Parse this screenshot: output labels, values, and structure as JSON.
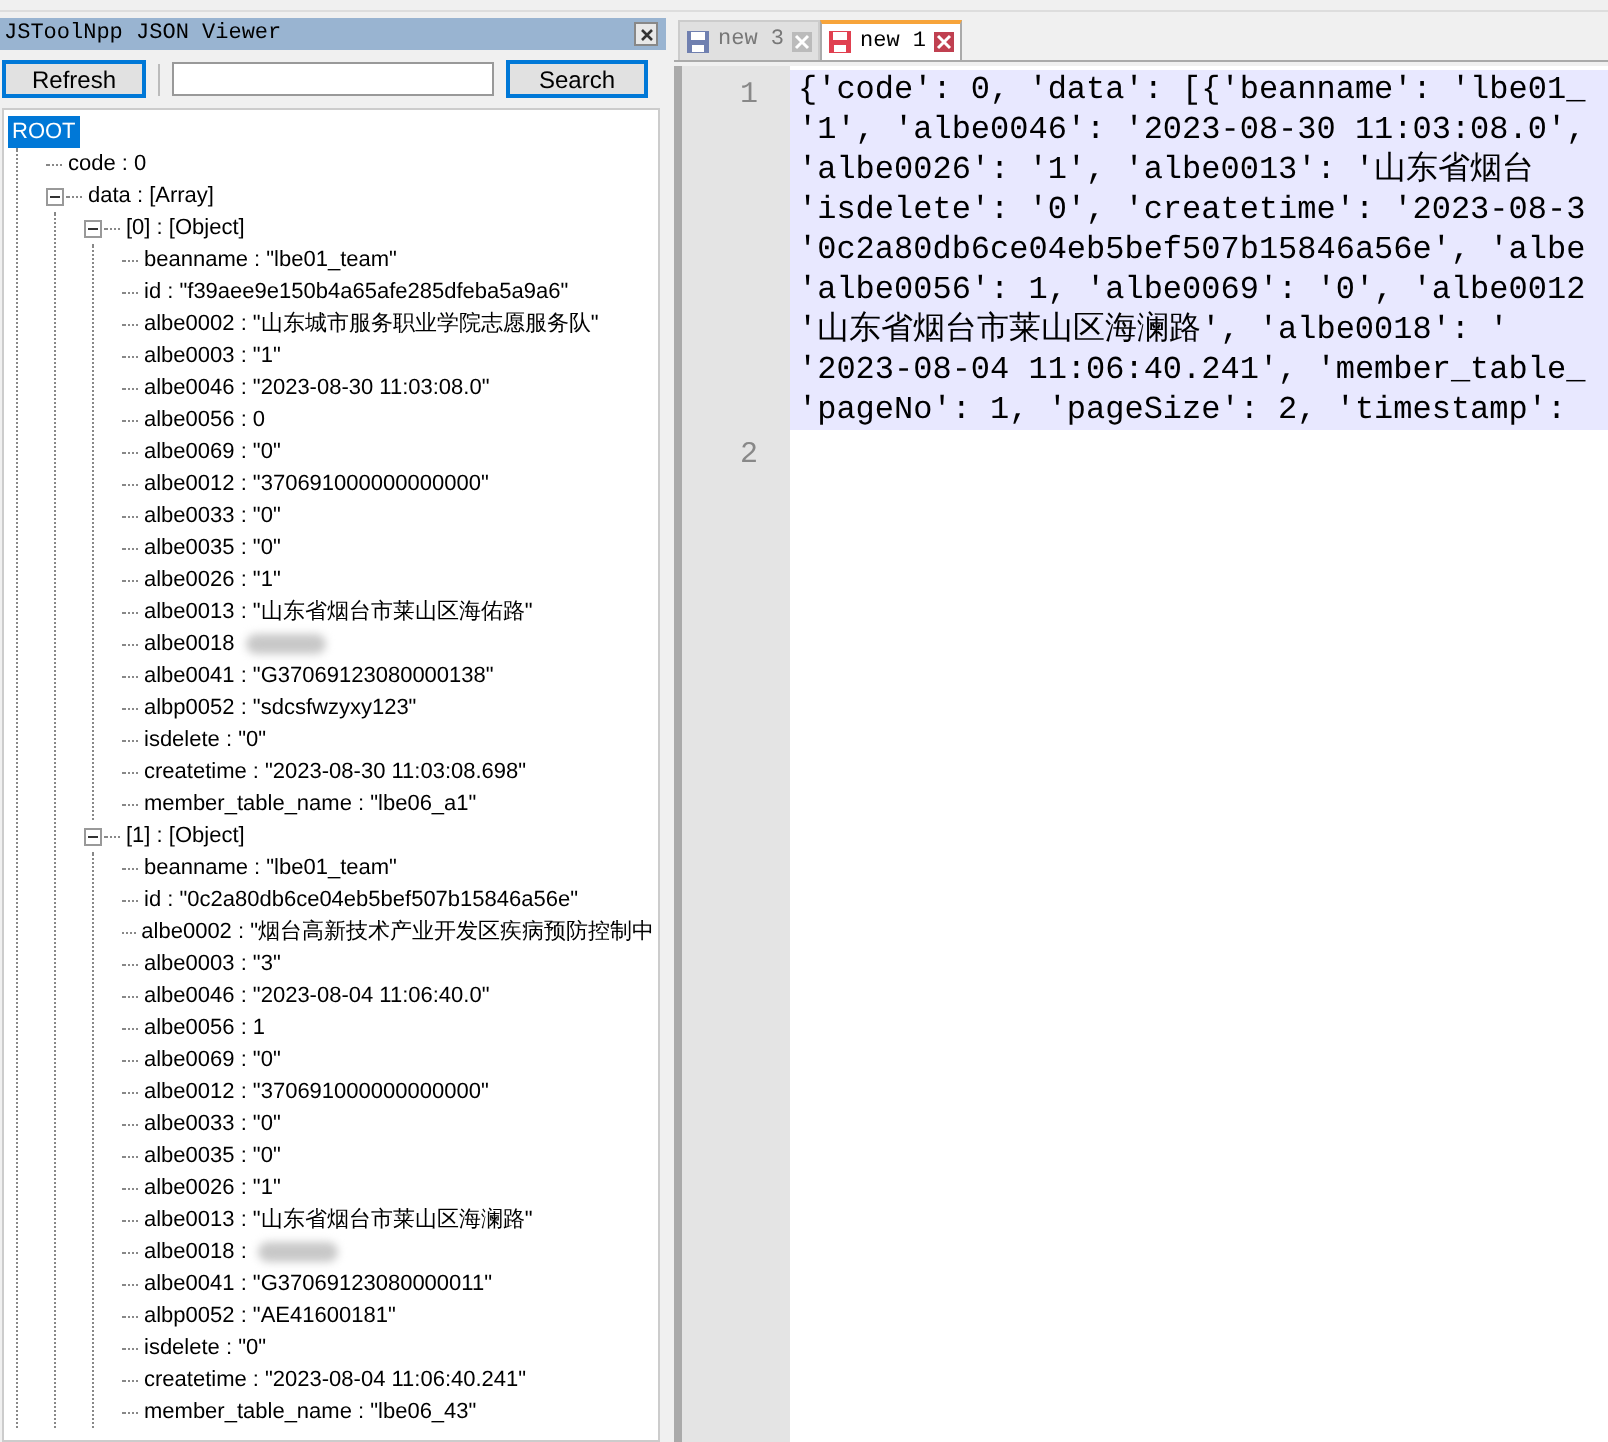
{
  "panel": {
    "title": "JSToolNpp JSON Viewer",
    "refresh_button": "Refresh",
    "search_button": "Search"
  },
  "tree": {
    "label": "ROOT",
    "selected": true,
    "children": [
      {
        "label": "code : 0"
      },
      {
        "label": "data : [Array]",
        "expanded": true,
        "children": [
          {
            "label": "[0] : [Object]",
            "expanded": true,
            "children": [
              {
                "label": "beanname : \"lbe01_team\""
              },
              {
                "label": "id : \"f39aee9e150b4a65afe285dfeba5a9a6\""
              },
              {
                "label": "albe0002 : \"山东城市服务职业学院志愿服务队\""
              },
              {
                "label": "albe0003 : \"1\""
              },
              {
                "label": "albe0046 : \"2023-08-30 11:03:08.0\""
              },
              {
                "label": "albe0056 : 0"
              },
              {
                "label": "albe0069 : \"0\""
              },
              {
                "label": "albe0012 : \"370691000000000000\""
              },
              {
                "label": "albe0033 : \"0\""
              },
              {
                "label": "albe0035 : \"0\""
              },
              {
                "label": "albe0026 : \"1\""
              },
              {
                "label": "albe0013 : \"山东省烟台市莱山区海佑路\""
              },
              {
                "label": "albe0018",
                "kind": "redacted"
              },
              {
                "label": "albe0041 : \"G37069123080000138\""
              },
              {
                "label": "albp0052 : \"sdcsfwzyxy123\""
              },
              {
                "label": "isdelete : \"0\""
              },
              {
                "label": "createtime : \"2023-08-30 11:03:08.698\""
              },
              {
                "label": "member_table_name : \"lbe06_a1\""
              }
            ]
          },
          {
            "label": "[1] : [Object]",
            "expanded": true,
            "children": [
              {
                "label": "beanname : \"lbe01_team\""
              },
              {
                "label": "id : \"0c2a80db6ce04eb5bef507b15846a56e\""
              },
              {
                "label": "albe0002 : \"烟台高新技术产业开发区疾病预防控制中"
              },
              {
                "label": "albe0003 : \"3\""
              },
              {
                "label": "albe0046 : \"2023-08-04 11:06:40.0\""
              },
              {
                "label": "albe0056 : 1"
              },
              {
                "label": "albe0069 : \"0\""
              },
              {
                "label": "albe0012 : \"370691000000000000\""
              },
              {
                "label": "albe0033 : \"0\""
              },
              {
                "label": "albe0035 : \"0\""
              },
              {
                "label": "albe0026 : \"1\""
              },
              {
                "label": "albe0013 : \"山东省烟台市莱山区海澜路\""
              },
              {
                "label": "albe0018 :",
                "kind": "redacted"
              },
              {
                "label": "albe0041 : \"G37069123080000011\""
              },
              {
                "label": "albp0052 : \"AE41600181\""
              },
              {
                "label": "isdelete : \"0\""
              },
              {
                "label": "createtime : \"2023-08-04 11:06:40.241\""
              },
              {
                "label": "member_table_name : \"lbe06_43\""
              }
            ]
          }
        ]
      }
    ]
  },
  "editor": {
    "tabs": [
      {
        "label": "new 3",
        "selected": false
      },
      {
        "label": "new 1",
        "selected": true
      }
    ],
    "lines": [
      {
        "number": "1",
        "selected": true,
        "text": [
          "{'code': 0, 'data': [{'beanname': 'lbe01_",
          "'1', 'albe0046': '2023-08-30 11:03:08.0',",
          "'albe0026': '1', 'albe0013': '山东省烟台",
          "'isdelete': '0', 'createtime': '2023-08-3",
          "'0c2a80db6ce04eb5bef507b15846a56e', 'albe",
          "'albe0056': 1, 'albe0069': '0', 'albe0012",
          "'山东省烟台市莱山区海澜路', 'albe0018': '",
          "'2023-08-04 11:06:40.241', 'member_table_",
          "'pageNo': 1, 'pageSize': 2, 'timestamp':"
        ]
      },
      {
        "number": "2",
        "selected": false
      }
    ]
  }
}
